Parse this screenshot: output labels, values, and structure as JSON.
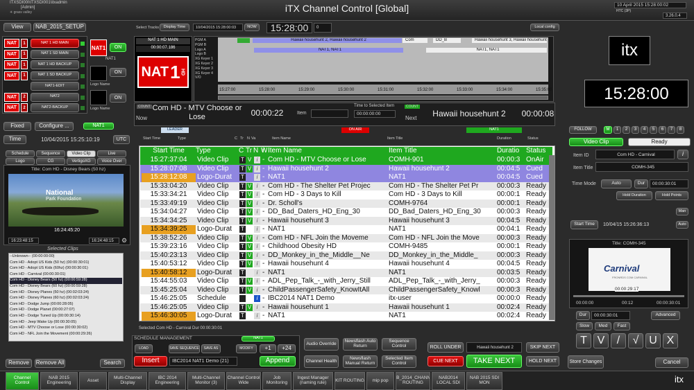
{
  "window": {
    "title": "iTX Channel Control [Global]",
    "login_line1": "ITXSDI00I\\ITXSDI001\\itxadmin",
    "login_line2": "[Admin]",
    "date": "10 April 2015 15:28:00:02",
    "version": "3.26.0.4",
    "htc": "HTC (3P)"
  },
  "toolbar": {
    "view": "View",
    "layout": "NAB_2015_SETUP",
    "select_tracks": "Select Tracks",
    "display_time": "Display Time",
    "timestamp": "10/04/2015 15:28:00:03",
    "now": "NOW",
    "clock": "15:28:00",
    "clock_offset": "0",
    "local_config": "Local config"
  },
  "channels": {
    "items": [
      {
        "logo": "NAT",
        "tag": "1",
        "name": "NAT 1 HD MAIN"
      },
      {
        "logo": "NAT",
        "tag": "1",
        "name": "NAT 1 SD MAIN"
      },
      {
        "logo": "NAT",
        "tag": "1",
        "name": "NAT 1 HD BACKUP"
      },
      {
        "logo": "NAT",
        "tag": "1",
        "name": "NAT 1 SD BACKUP"
      },
      {
        "logo": "",
        "tag": "",
        "name": "NAT1-EDIT"
      },
      {
        "logo": "NAT",
        "tag": "2",
        "name": "NAT2"
      },
      {
        "logo": "NAT",
        "tag": "2",
        "name": "NAT2-BACKUP"
      }
    ],
    "on1": "ON",
    "on2": "ON",
    "on3": "ON",
    "channel_name": "NAT1",
    "logo_name": "Logo Name",
    "logo_name2": "Logo Name"
  },
  "preview": {
    "channel": "NAT 1 HD MAIN",
    "tc": "00:00:07.186",
    "logo": "NAT",
    "logo_num": "1",
    "logo_sub": "HD"
  },
  "timeline": {
    "tracks": [
      "PGM A",
      "PGM B",
      "Logo A",
      "Logo B",
      "XG Keyer 1",
      "XG Keyer 2",
      "XG Keyer 3",
      "XG Keyer 4",
      "V/O"
    ],
    "com": "Com",
    "dd_b": "DD_B",
    "hawaii_center": "Hawaii househunt 2, Hawaii househunt 2",
    "hawaii_right": "Hawaii househunt 3, Hawaii househunt 3",
    "nat_center": "NAT1, NAT1",
    "nat_right": "NAT1, NAT1",
    "times": [
      "15:27:00",
      "15:28:00",
      "15:29:00",
      "15:30:00",
      "15:31:00",
      "15:32:00",
      "15:33:00",
      "15:34:00",
      "15:35:00"
    ]
  },
  "now_next": {
    "now_count": "COUNT",
    "now_label": "Now",
    "now_title": "Com HD - MTV Choose or Lose",
    "now_remaining": "00:00:22",
    "item_label": "Item",
    "time_to_selected": "Time to Selected Item",
    "tts_value": "00:00:00:00",
    "next_count": "COUNT",
    "next_label": "Next",
    "next_title": "Hawaii househunt 2",
    "next_remaining": "00:00:08"
  },
  "left": {
    "fixed": "Fixed",
    "configure": "Configure ...",
    "nat1": "NAT1",
    "time": "Time",
    "datetime": "10/04/2015 15:25:10:19",
    "utc": "UTC",
    "tabs": [
      "Schedule",
      "Sequence",
      "Video Clip",
      "Live",
      "Logo",
      "CG",
      "VertigoXG",
      "Voice Over"
    ],
    "clip_title": "Title: Com HD - Disney Bears (50 hz)",
    "clip_tc": "16:24:45:20",
    "in_tc": "16:23:48:15",
    "out_tc": "16:24:48:15",
    "np_line1": "National",
    "np_line2": "Park Foundation",
    "selected_clips": "Selected Clips",
    "clips": [
      "--Unknown-- (00:00:00:00)",
      "Com HD - Adopt US Kids (50 hz) (00:00:30:01)",
      "Com HD - Adopt US Kids (60hz) (00:00:30:01)",
      "Com HD - Carnival (00:00:30:01)",
      "Com HD - Disney Bears (50 hz) (00:00:59:28)",
      "Com HD - Disney Bears (60 hz) (00:00:59:28)",
      "Com HD - Disney Planes (50 hz) (00:02:03:24)",
      "Com HD - Disney Planes (60 hz) (00:02:03:24)",
      "Com HD - Dodge Jump (00:00:28:05)",
      "Com HD - Dodge Planet (00:00:27:07)",
      "Com HD - Dodge Tuned Up (00:00:30:14)",
      "Com HD - Jeep Wake Up (00:00:30:05)",
      "Com HD - MTV Choose or Lose (00:00:30:02)",
      "Com HD - NFL Join the Movement (00:00:29:26)"
    ],
    "remove": "Remove",
    "remove_all": "Remove All",
    "search": "Search"
  },
  "schedule": {
    "leader": "LEADER",
    "on_air": "ON AIR",
    "nat1": "NAT1",
    "mini_headers": [
      "Start Time",
      "Type",
      "C",
      "Tr",
      "N",
      "Va",
      "Item Name",
      "Item Title",
      "Duration",
      "Status"
    ],
    "headers": [
      "Start Time",
      "Type",
      "C",
      "Tr",
      "N",
      "W",
      "i",
      "Item Name",
      "Item Title",
      "Duratio",
      "Status"
    ],
    "rows": [
      {
        "start": "15:27:37:04",
        "type": "Video Clip",
        "name": "Com HD - MTV Choose or Lose",
        "title": "COMH-901",
        "dur": "00:00:3",
        "status": "OnAir",
        "style": "onair"
      },
      {
        "start": "15:28:07:08",
        "type": "Video Clip",
        "name": "Hawaii househunt 2",
        "title": "Hawaii househunt 2",
        "dur": "00:04:5",
        "status": "Cued",
        "style": "cued"
      },
      {
        "start": "15:28:12:08",
        "type": "Logo-Durat",
        "name": "NAT1",
        "title": "NAT1",
        "dur": "00:04:5",
        "status": "Cued",
        "style": "cued"
      },
      {
        "start": "15:33:04:20",
        "type": "Video Clip",
        "name": "Com HD - The Shelter Pet Projec",
        "title": "Com HD - The Shelter Pet Pr",
        "dur": "00:00:3",
        "status": "Ready",
        "style": ""
      },
      {
        "start": "15:33:34:21",
        "type": "Video Clip",
        "name": "Com HD - 3 Days to Kill",
        "title": "Com HD - 3 Days to Kill",
        "dur": "00:00:1",
        "status": "Ready",
        "style": ""
      },
      {
        "start": "15:33:49:19",
        "type": "Video Clip",
        "name": "Dr. Scholl's",
        "title": "COMH-9764",
        "dur": "00:00:1",
        "status": "Ready",
        "style": ""
      },
      {
        "start": "15:34:04:27",
        "type": "Video Clip",
        "name": "DD_Bad_Daters_HD_Eng_30",
        "title": "DD_Bad_Daters_HD_Eng_30",
        "dur": "00:00:3",
        "status": "Ready",
        "style": ""
      },
      {
        "start": "15:34:34:25",
        "type": "Video Clip",
        "name": "Hawaii househunt 3",
        "title": "Hawaii househunt 3",
        "dur": "00:04:5",
        "status": "Ready",
        "style": ""
      },
      {
        "start": "15:34:39:25",
        "type": "Logo-Durat",
        "name": "NAT1",
        "title": "NAT1",
        "dur": "00:04:1",
        "status": "Ready",
        "style": "logo"
      },
      {
        "start": "15:38:52:26",
        "type": "Video Clip",
        "name": "Com HD - NFL Join the Moveme",
        "title": "Com HD - NFL Join the Move",
        "dur": "00:00:3",
        "status": "Ready",
        "style": ""
      },
      {
        "start": "15:39:23:16",
        "type": "Video Clip",
        "name": "Childhood Obesity HD",
        "title": "COMH-9485",
        "dur": "00:00:1",
        "status": "Ready",
        "style": ""
      },
      {
        "start": "15:40:23:13",
        "type": "Video Clip",
        "name": "DD_Monkey_in_the_Middle__Ne",
        "title": "DD_Monkey_in_the_Middle_",
        "dur": "00:00:3",
        "status": "Ready",
        "style": ""
      },
      {
        "start": "15:40:53:12",
        "type": "Video Clip",
        "name": "Hawaii househunt 4",
        "title": "Hawaii househunt 4",
        "dur": "00:04:5",
        "status": "Ready",
        "style": ""
      },
      {
        "start": "15:40:58:12",
        "type": "Logo-Durat",
        "name": "NAT1",
        "title": "NAT1",
        "dur": "00:03:5",
        "status": "Ready",
        "style": "logo"
      },
      {
        "start": "15:44:55:03",
        "type": "Video Clip",
        "name": "ADL_Pep_Talk_-_with_Jerry_Still",
        "title": "ADL_Pep_Talk_-_with_Jerry_",
        "dur": "00:00:3",
        "status": "Ready",
        "style": ""
      },
      {
        "start": "15:45:25:04",
        "type": "Video Clip",
        "name": "ChildPassengerSafety_KnowItAll",
        "title": "ChildPassengerSafety_Knowl",
        "dur": "00:00:3",
        "status": "Ready",
        "style": ""
      },
      {
        "start": "15:46:25:05",
        "type": "Schedule",
        "name": "IBC2014 NAT1 Demo",
        "title": "itx-user",
        "dur": "00:00:0",
        "status": "Ready",
        "style": ""
      },
      {
        "start": "15:46:25:05",
        "type": "Video Clip",
        "name": "Hawaii househunt 1",
        "title": "Hawaii househunt 1",
        "dur": "00:02:4",
        "status": "Ready",
        "style": ""
      },
      {
        "start": "15:46:30:05",
        "type": "Logo-Durat",
        "name": "NAT1",
        "title": "NAT1",
        "dur": "00:02:4",
        "status": "Ready",
        "style": "logo"
      }
    ],
    "status_line": "Selected Com HD - Carnival Dur 00:00:30:01"
  },
  "management": {
    "title": "SCHEDULE MANAGEMENT",
    "nat1": "NAT1",
    "load": "LOAD",
    "save_sequence": "SAVE SEQUENCE",
    "save_as": "SAVE AS",
    "modify": "MODIFY",
    "plus1": "+1",
    "plus24": "+24",
    "insert": "Insert",
    "schedule_name": "IBC2014 NAT1 Demo (21)",
    "append": "Append",
    "audio_override": "Audio Override",
    "newsflash_auto": "Newsflash Auto Return",
    "sequence_control": "Sequence Control",
    "channel_health": "Channel Health",
    "newsflash_manual": "Newsflash Manual Return",
    "selected_item_control": "Selected Item Control",
    "roll_under": "ROLL UNDER",
    "next_item": "Hawaii househunt 2",
    "skip_next": "SKIP NEXT",
    "cue_next": "CUE NEXT",
    "take_next": "TAKE NEXT",
    "hold_next": "HOLD NEXT"
  },
  "right": {
    "logo": "itx",
    "clock": "15:28:00",
    "follow": "FOLLOW",
    "m": "M",
    "numbers": [
      "1",
      "2",
      "3",
      "4",
      "5",
      "6",
      "7",
      "8"
    ],
    "video_clip": "Video Clip",
    "ready": "Ready",
    "item_id_label": "Item ID",
    "item_id": "Com HD - Carnival",
    "item_title_label": "Item Title",
    "item_title": "COMH-345",
    "time_mode": "Time Mode",
    "auto": "Auto",
    "dur": "Dur",
    "dur_value": "00:00:30:01",
    "hold_duration": "Hold Duration",
    "hold_points": "Hold Points",
    "man": "Man",
    "start_time": "Start Time",
    "start_value": "10/04/15 15:26:36:13",
    "auto2": "Auto",
    "preview_title": "Title: COMH-345",
    "carnival": "Carnival",
    "carnival_sub": "FRONRDS COM CARNIVAL",
    "preview_tc": "00:00:29:17",
    "in_tc": "00:00:00",
    "mid_tc": "00:12",
    "out_tc": "00:00:30:01",
    "dur2": "Dur",
    "dur2_value": "00:00:30:01",
    "advanced": "Advanced",
    "slow": "Slow",
    "med": "Med",
    "fast": "Fast",
    "store": "Store Changes",
    "cancel": "Cancel"
  },
  "taskbar": {
    "tabs": [
      "Channel Control",
      "NAB 2015 Engineering",
      "Asset",
      "Multi-Channel Display",
      "IBC 2014 Engineering",
      "Multi-Channel Monitor (3)",
      "Channel Control Wide",
      "Job Monitoring",
      "Ingest Manager (naming rule)",
      "KIT ROUTING",
      "mip pop",
      "NAB_2014_CHANNEL ROUTING",
      "NAB2014 LOCAL SDI",
      "NAB 2015 SDI MON"
    ],
    "logo": "itx"
  },
  "colors": {
    "green": "#1fa81f",
    "onair": "#1fa81f",
    "cued": "#9b8fe0",
    "logo": "#e8a020",
    "red": "#d40000",
    "timeline_blue": "#8f90e8"
  }
}
